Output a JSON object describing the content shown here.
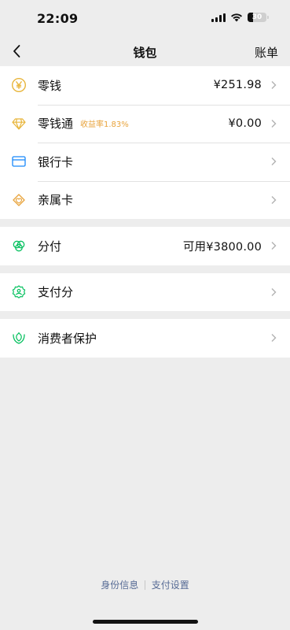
{
  "status_bar": {
    "time": "22:09",
    "battery": "30"
  },
  "nav": {
    "title": "钱包",
    "right": "账单"
  },
  "groups": [
    {
      "items": [
        {
          "label": "零钱",
          "value": "¥251.98",
          "icon": "yen-coin-icon"
        },
        {
          "label": "零钱通",
          "tag": "收益率1.83%",
          "value": "¥0.00",
          "icon": "diamond-icon"
        },
        {
          "label": "银行卡",
          "icon": "bank-card-icon"
        },
        {
          "label": "亲属卡",
          "icon": "family-card-icon"
        }
      ]
    },
    {
      "items": [
        {
          "label": "分付",
          "value": "可用¥3800.00",
          "icon": "fenfu-icon"
        }
      ]
    },
    {
      "items": [
        {
          "label": "支付分",
          "icon": "payscore-icon"
        }
      ]
    },
    {
      "items": [
        {
          "label": "消费者保护",
          "icon": "consumer-protection-icon"
        }
      ]
    }
  ],
  "footer": {
    "identity": "身份信息",
    "settings": "支付设置"
  },
  "colors": {
    "green": "#07c160",
    "gold": "#e8a33b",
    "blue": "#1989fa",
    "link": "#576b95"
  }
}
